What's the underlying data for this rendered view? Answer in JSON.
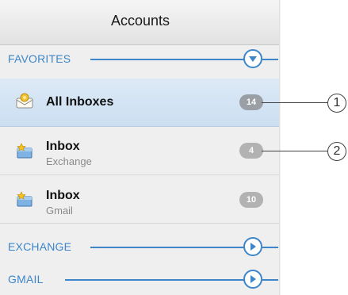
{
  "header": {
    "title": "Accounts"
  },
  "sections": [
    {
      "label": "FAVORITES",
      "control": "collapse-down-icon"
    },
    {
      "label": "EXCHANGE",
      "control": "expand-right-icon"
    },
    {
      "label": "GMAIL",
      "control": "expand-right-icon"
    }
  ],
  "favorites": [
    {
      "title": "All Inboxes",
      "subtitle": "",
      "badge": "14",
      "icon": "all-inboxes-icon",
      "selected": true
    },
    {
      "title": "Inbox",
      "subtitle": "Exchange",
      "badge": "4",
      "icon": "inbox-favorite-icon",
      "selected": false
    },
    {
      "title": "Inbox",
      "subtitle": "Gmail",
      "badge": "10",
      "icon": "inbox-favorite-icon",
      "selected": false
    }
  ],
  "callouts": [
    "1",
    "2"
  ],
  "colors": {
    "accent": "#3d86c9",
    "selected_row": "#cfe1f3",
    "badge": "#a6a6a6"
  }
}
